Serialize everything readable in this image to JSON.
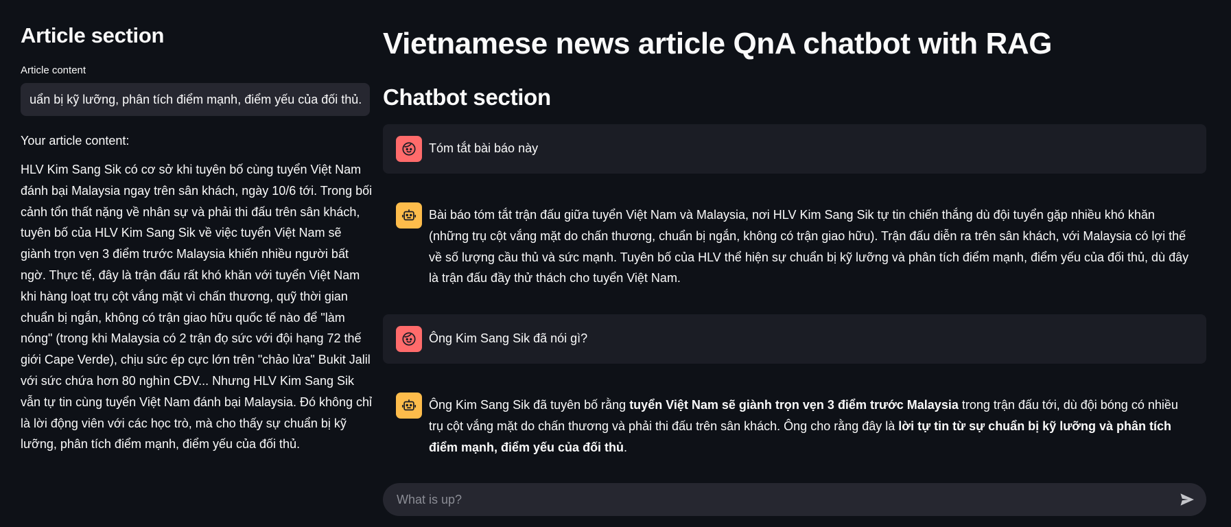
{
  "sidebar": {
    "title": "Article section",
    "input_label": "Article content",
    "input_value": "HLV Kim Sang Sik có cơ sở khi tuyên bố cùng tuyển Việt Nam đánh bại Malaysia... Đó không chỉ là lời động viên với các học trò, mà cho thấy sự chuẩn bị kỹ lưỡng, phân tích điểm mạnh, điểm yếu của đối thủ.",
    "content_label": "Your article content:",
    "content_text": "HLV Kim Sang Sik có cơ sở khi tuyên bố cùng tuyển Việt Nam đánh bại Malaysia ngay trên sân khách, ngày 10/6 tới. Trong bối cảnh tổn thất nặng về nhân sự và phải thi đấu trên sân khách, tuyên bố của HLV Kim Sang Sik về việc tuyển Việt Nam sẽ giành trọn vẹn 3 điểm trước Malaysia khiến nhiều người bất ngờ. Thực tế, đây là trận đấu rất khó khăn với tuyển Việt Nam khi hàng loạt trụ cột vắng mặt vì chấn thương, quỹ thời gian chuẩn bị ngắn, không có trận giao hữu quốc tế nào để \"làm nóng\" (trong khi Malaysia có 2 trận đọ sức với đội hạng 72 thế giới Cape Verde), chịu sức ép cực lớn trên \"chảo lửa\" Bukit Jalil với sức chứa hơn 80 nghìn CĐV... Nhưng HLV Kim Sang Sik vẫn tự tin cùng tuyển Việt Nam đánh bại Malaysia. Đó không chỉ là lời động viên với các học trò, mà cho thấy sự chuẩn bị kỹ lưỡng, phân tích điểm mạnh, điểm yếu của đối thủ."
  },
  "main": {
    "title": "Vietnamese news article QnA chatbot with RAG",
    "section_title": "Chatbot section"
  },
  "messages": [
    {
      "role": "user",
      "text": "Tóm tắt bài báo này"
    },
    {
      "role": "assistant",
      "text": "Bài báo tóm tắt trận đấu giữa tuyển Việt Nam và Malaysia, nơi HLV Kim Sang Sik tự tin chiến thắng dù đội tuyển gặp nhiều khó khăn (những trụ cột vắng mặt do chấn thương, chuẩn bị ngắn, không có trận giao hữu). Trận đấu diễn ra trên sân khách, với Malaysia có lợi thế về số lượng cầu thủ và sức mạnh. Tuyên bố của HLV thể hiện sự chuẩn bị kỹ lưỡng và phân tích điểm mạnh, điểm yếu của đối thủ, dù đây là trận đấu đầy thử thách cho tuyển Việt Nam."
    },
    {
      "role": "user",
      "text": "Ông Kim Sang Sik đã nói gì?"
    },
    {
      "role": "assistant",
      "parts": [
        "Ông Kim Sang Sik đã tuyên bố rằng ",
        "tuyển Việt Nam sẽ giành trọn vẹn 3 điểm trước Malaysia",
        " trong trận đấu tới, dù đội bóng có nhiều trụ cột vắng mặt do chấn thương và phải thi đấu trên sân khách. Ông cho rằng đây là ",
        "lời tự tin từ sự chuẩn bị kỹ lưỡng và phân tích điểm mạnh, điểm yếu của đối thủ",
        "."
      ]
    }
  ],
  "chat_input": {
    "placeholder": "What is up?"
  },
  "icons": {
    "user_avatar": "face-icon",
    "bot_avatar": "robot-icon",
    "send": "send-icon"
  },
  "colors": {
    "background": "#0e1117",
    "user_avatar": "#ff6b6b",
    "bot_avatar": "#fdbc4b",
    "input_bg": "#262730"
  }
}
